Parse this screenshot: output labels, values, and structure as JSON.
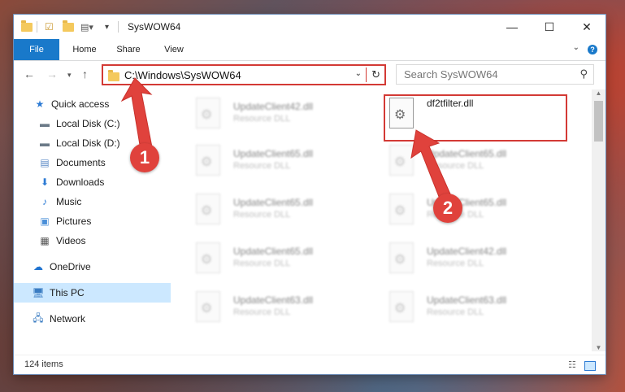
{
  "window": {
    "title": "SysWOW64",
    "controls": {
      "minimize": "—",
      "maximize": "☐",
      "close": "✕"
    }
  },
  "ribbon": {
    "tabs": [
      {
        "label": "File"
      },
      {
        "label": "Home"
      },
      {
        "label": "Share"
      },
      {
        "label": "View"
      }
    ]
  },
  "address": {
    "path": "C:\\Windows\\SysWOW64",
    "search_placeholder": "Search SysWOW64"
  },
  "nav": {
    "quick_access": "Quick access",
    "items": [
      {
        "label": "Local Disk (C:)"
      },
      {
        "label": "Local Disk (D:)"
      },
      {
        "label": "Documents"
      },
      {
        "label": "Downloads"
      },
      {
        "label": "Music"
      },
      {
        "label": "Pictures"
      },
      {
        "label": "Videos"
      }
    ],
    "onedrive": "OneDrive",
    "this_pc": "This PC",
    "network": "Network"
  },
  "files": {
    "left_column": [
      {
        "name": "UpdateClient42.dll",
        "type": "Resource DLL"
      },
      {
        "name": "UpdateClient65.dll",
        "type": "Resource DLL"
      },
      {
        "name": "UpdateClient65.dll",
        "type": "Resource DLL"
      },
      {
        "name": "UpdateClient65.dll",
        "type": "Resource DLL"
      },
      {
        "name": "UpdateClient63.dll",
        "type": "Resource DLL"
      }
    ],
    "right_column": [
      {
        "name": "df2tfilter.dll",
        "type": ""
      },
      {
        "name": "UpdateClient65.dll",
        "type": "Resource DLL"
      },
      {
        "name": "UpdateClient65.dll",
        "type": "Resource DLL"
      },
      {
        "name": "UpdateClient42.dll",
        "type": "Resource DLL"
      },
      {
        "name": "UpdateClient63.dll",
        "type": "Resource DLL"
      }
    ]
  },
  "status": {
    "item_count": "124 items"
  },
  "annotations": {
    "step1": "1",
    "step2": "2"
  },
  "colors": {
    "accent": "#1979ca",
    "annotation": "#e0423c",
    "selection": "#cce8ff"
  }
}
